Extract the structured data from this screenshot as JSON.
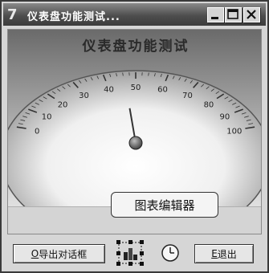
{
  "window": {
    "app_icon_glyph": "7",
    "title": "仪表盘功能测试...",
    "controls": {
      "minimize": "minimize",
      "maximize": "maximize",
      "close": "close"
    }
  },
  "gauge": {
    "title": "仪表盘功能测试",
    "min": 0,
    "max": 100,
    "major_ticks": [
      0,
      10,
      20,
      30,
      40,
      50,
      60,
      70,
      80,
      90,
      100
    ],
    "needle_value": 43,
    "colors": {
      "face_top": "#9a9a9a",
      "face_bottom": "#ffffff",
      "dial_fill": "#f2f2f2",
      "needle": "#333333",
      "hub": "#5a5a5a"
    }
  },
  "tooltip": {
    "text": "图表编辑器"
  },
  "toolbar": {
    "export_button": {
      "mnemonic": "O",
      "label": "导出对话框"
    },
    "chart_editor_icon": "chart-editor-icon",
    "clock_icon": "clock-icon",
    "exit_button": {
      "mnemonic": "E",
      "label": "退出"
    }
  }
}
